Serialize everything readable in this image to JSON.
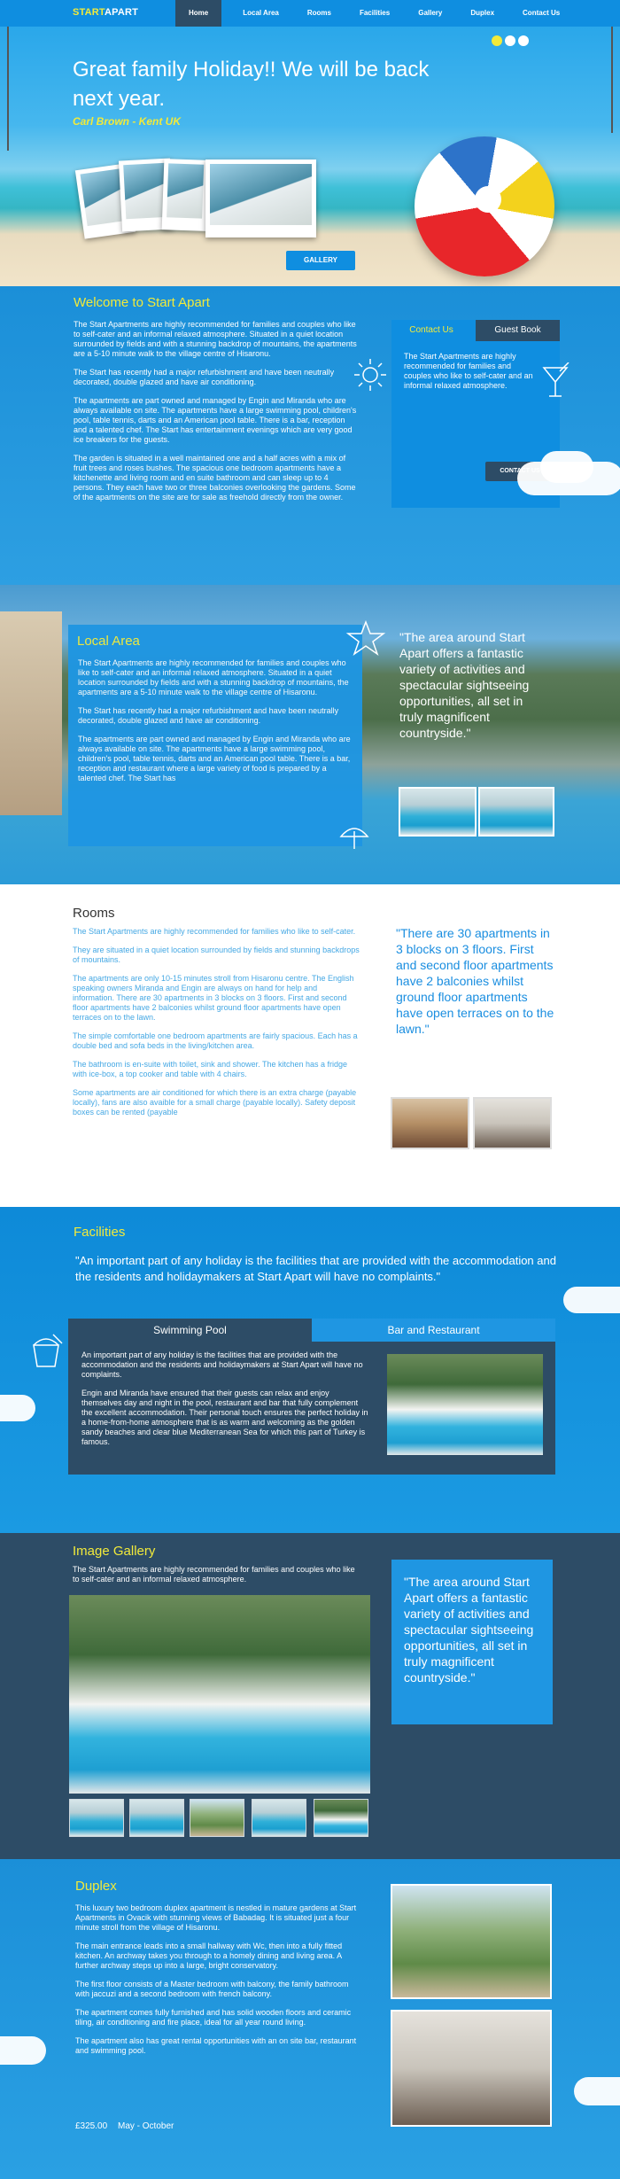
{
  "nav": {
    "logo_part1": "START",
    "logo_part2": "APART",
    "links": [
      "Home",
      "Local Area",
      "Rooms",
      "Facilities",
      "Gallery",
      "Duplex",
      "Contact Us"
    ]
  },
  "hero": {
    "headline": "Great family Holiday!! We will be back next year.",
    "author": "Carl Brown - Kent UK",
    "gallery_button": "GALLERY",
    "slides_total": 3,
    "slide_active": 1
  },
  "welcome": {
    "title": "Welcome to Start Apart",
    "paragraphs": [
      "The Start Apartments are highly recommended for families and couples who like to self-cater and an informal relaxed atmosphere. Situated in a quiet location surrounded by fields and with a stunning backdrop of mountains, the apartments are a 5-10 minute walk to the village centre of Hisaronu.",
      "The Start has recently had a major refurbishment and have been neutrally decorated, double glazed and have air conditioning.",
      "The apartments are part owned and managed by Engin and Miranda who are always available on site. The apartments have a large swimming pool, children's pool, table tennis, darts and an American pool table. There is a bar, reception and a talented chef. The Start has entertainment evenings which are very good ice breakers for the guests.",
      "The garden is situated in a well maintained one and a half acres with a mix of fruit trees and roses bushes. The spacious one bedroom apartments have a kitchenette and living room and en suite bathroom and can sleep up to 4 persons. They each have two or three balconies overlooking the gardens. Some of the apartments on the site are for sale as freehold directly from the owner."
    ],
    "tab_contact": "Contact Us",
    "tab_guestbook": "Guest Book",
    "contact_text": "The Start Apartments are highly recommended for families and couples who like to self-cater and an informal relaxed atmosphere.",
    "contact_button": "CONTACT US"
  },
  "local": {
    "title": "Local Area",
    "paragraphs": [
      "The Start Apartments are highly recommended for families and couples who like to self-cater and an informal relaxed atmosphere. Situated in a quiet location surrounded by fields and with a stunning backdrop of mountains, the apartments are a 5-10 minute walk to the village centre of Hisaronu.",
      "The Start has recently had a major refurbishment and have been neutrally decorated, double glazed and have air conditioning.",
      "The apartments are part owned and managed by Engin and Miranda who are always available on site. The apartments have a large swimming pool, children's pool, table tennis, darts and an American pool table. There is a bar, reception and restaurant where a large variety of food is prepared by a talented chef. The Start has"
    ],
    "quote": "\"The area around Start Apart offers a fantastic variety of activities and spectacular sightseeing opportunities, all set in truly magnificent countryside.\""
  },
  "rooms": {
    "title": "Rooms",
    "paragraphs": [
      "The Start Apartments are highly recommended for families who like to self-cater.",
      "They are situated in a quiet location surrounded by fields and stunning backdrops of mountains.",
      "The apartments are only 10-15 minutes stroll from Hisaronu centre. The English speaking owners Miranda and Engin are always on hand for help and information. There are 30 apartments in 3 blocks on 3 floors. First and second floor apartments have 2 balconies whilst ground floor apartments have open terraces on to the lawn.",
      "The simple comfortable one bedroom apartments are fairly spacious. Each has a double bed and sofa beds in the living/kitchen area.",
      "The bathroom is en-suite with toilet, sink and shower. The kitchen has a fridge with ice-box, a top cooker and table with 4 chairs.",
      "Some apartments are air conditioned for which there is an extra charge (payable locally), fans are also avaible for a small charge (payable locally). Safety deposit boxes can be rented (payable"
    ],
    "quote": "\"There are 30 apartments in 3 blocks on 3 floors. First and second floor apartments have 2 balconies whilst ground floor apartments have open terraces on to the lawn.\""
  },
  "facilities": {
    "title": "Facilities",
    "quote": "\"An important part of any holiday is the facilities that are provided with the accommodation and the residents and holidaymakers at Start Apart will have no complaints.\"",
    "tab_pool": "Swimming Pool",
    "tab_bar": "Bar and Restaurant",
    "paragraphs": [
      "An important part of any holiday is the facilities that are provided with the accommodation and the residents and holidaymakers at Start Apart will have no complaints.",
      "Engin and Miranda have ensured that their guests can relax and enjoy themselves day and night in the pool, restaurant and bar that fully complement the excellent accommodation. Their personal touch ensures the perfect holiday in a home-from-home atmosphere that is as warm and welcoming as the golden sandy beaches and clear blue Mediterranean Sea for which this part of Turkey is famous."
    ]
  },
  "gallery": {
    "title": "Image Gallery",
    "intro": "The Start Apartments are highly recommended for families and couples who like to self-cater and an informal relaxed atmosphere.",
    "quote": "\"The area around Start Apart offers a fantastic variety of activities and spectacular sightseeing opportunities, all set in truly magnificent countryside.\"",
    "thumbnails_count": 5
  },
  "duplex": {
    "title": "Duplex",
    "paragraphs": [
      "This luxury two bedroom duplex apartment is nestled in mature gardens at Start Apartments in Ovacik with stunning views of Babadag. It is situated just a four minute stroll from the village of Hisaronu.",
      "The main entrance leads into a small hallway with Wc, then into a fully fitted kitchen. An archway takes you through to a homely dining and living area. A further archway steps up into a large, bright conservatory.",
      "The first floor consists of a Master bedroom with balcony, the family bathroom with jaccuzi and a second bedroom with french balcony.",
      "The apartment comes fully furnished and has solid wooden floors and ceramic tiling, air conditioning and fire place, ideal for all year round living.",
      "The apartment also has great rental opportunities with an on site bar, restaurant and swimming pool."
    ],
    "price": "£325.00",
    "season": "May - October"
  },
  "colors": {
    "accent": "#f2ea3a",
    "primary": "#0f8ee0",
    "dark": "#2d4c66"
  }
}
